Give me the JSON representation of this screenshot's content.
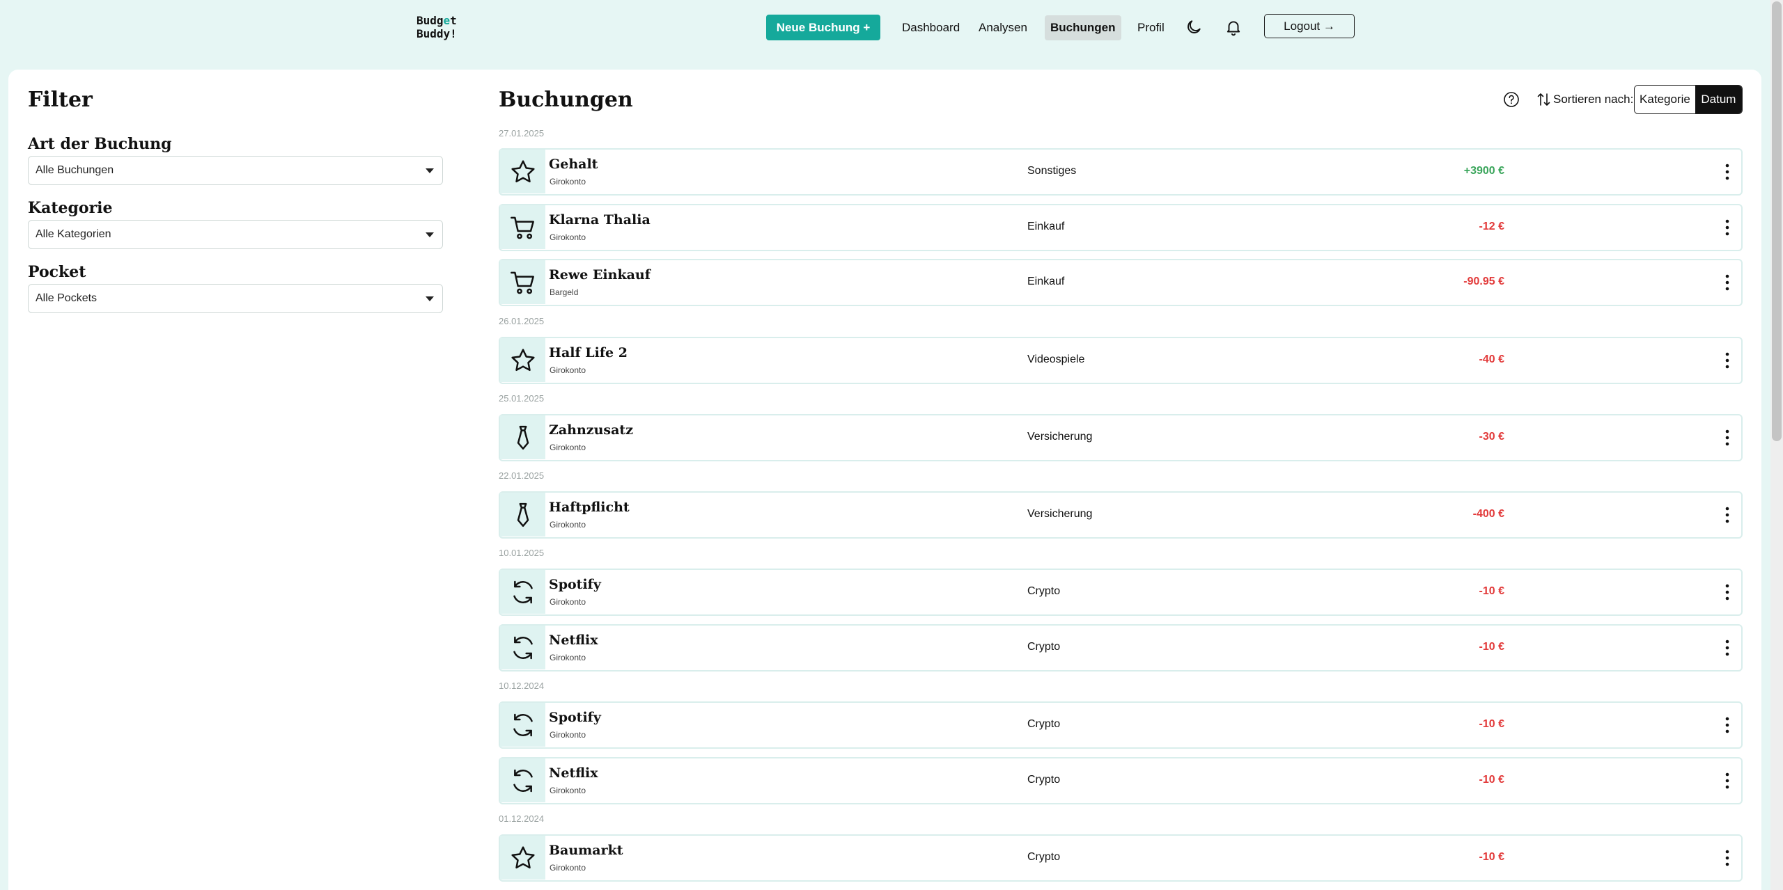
{
  "app": {
    "logo_line1_a": "Budg",
    "logo_line1_b": "e",
    "logo_line1_c": "t",
    "logo_line2": "Buddy!",
    "accent_color": "#15a99b"
  },
  "nav": {
    "new_booking": "Neue Buchung +",
    "dashboard": "Dashboard",
    "analyses": "Analysen",
    "bookings": "Buchungen",
    "profile": "Profil",
    "theme_icon": "moon-icon",
    "notify_icon": "bell-icon",
    "logout": "Logout →"
  },
  "filter": {
    "title": "Filter",
    "type_label": "Art der Buchung",
    "type_value": "Alle Buchungen",
    "category_label": "Kategorie",
    "category_value": "Alle Kategorien",
    "pocket_label": "Pocket",
    "pocket_value": "Alle Pockets"
  },
  "list": {
    "title": "Buchungen",
    "sort_label": "Sortieren nach:",
    "sort_options": [
      "Kategorie",
      "Datum"
    ],
    "sort_selected": "Datum",
    "groups": [
      {
        "date": "27.01.2025",
        "items": [
          {
            "icon": "star",
            "name": "Gehalt",
            "account": "Girokonto",
            "category": "Sonstiges",
            "amount": "+3900 €",
            "sign": "pos"
          },
          {
            "icon": "cart",
            "name": "Klarna Thalia",
            "account": "Girokonto",
            "category": "Einkauf",
            "amount": "-12 €",
            "sign": "neg"
          },
          {
            "icon": "cart",
            "name": "Rewe Einkauf",
            "account": "Bargeld",
            "category": "Einkauf",
            "amount": "-90.95 €",
            "sign": "neg"
          }
        ]
      },
      {
        "date": "26.01.2025",
        "items": [
          {
            "icon": "star",
            "name": "Half Life 2",
            "account": "Girokonto",
            "category": "Videospiele",
            "amount": "-40 €",
            "sign": "neg"
          }
        ]
      },
      {
        "date": "25.01.2025",
        "items": [
          {
            "icon": "tie",
            "name": "Zahnzusatz",
            "account": "Girokonto",
            "category": "Versicherung",
            "amount": "-30 €",
            "sign": "neg"
          }
        ]
      },
      {
        "date": "22.01.2025",
        "items": [
          {
            "icon": "tie",
            "name": "Haftpflicht",
            "account": "Girokonto",
            "category": "Versicherung",
            "amount": "-400 €",
            "sign": "neg"
          }
        ]
      },
      {
        "date": "10.01.2025",
        "items": [
          {
            "icon": "refresh",
            "name": "Spotify",
            "account": "Girokonto",
            "category": "Crypto",
            "amount": "-10 €",
            "sign": "neg"
          },
          {
            "icon": "refresh",
            "name": "Netflix",
            "account": "Girokonto",
            "category": "Crypto",
            "amount": "-10 €",
            "sign": "neg"
          }
        ]
      },
      {
        "date": "10.12.2024",
        "items": [
          {
            "icon": "refresh",
            "name": "Spotify",
            "account": "Girokonto",
            "category": "Crypto",
            "amount": "-10 €",
            "sign": "neg"
          },
          {
            "icon": "refresh",
            "name": "Netflix",
            "account": "Girokonto",
            "category": "Crypto",
            "amount": "-10 €",
            "sign": "neg"
          }
        ]
      },
      {
        "date": "01.12.2024",
        "items": [
          {
            "icon": "star",
            "name": "Baumarkt",
            "account": "Girokonto",
            "category": "Crypto",
            "amount": "-10 €",
            "sign": "neg"
          }
        ]
      }
    ]
  }
}
